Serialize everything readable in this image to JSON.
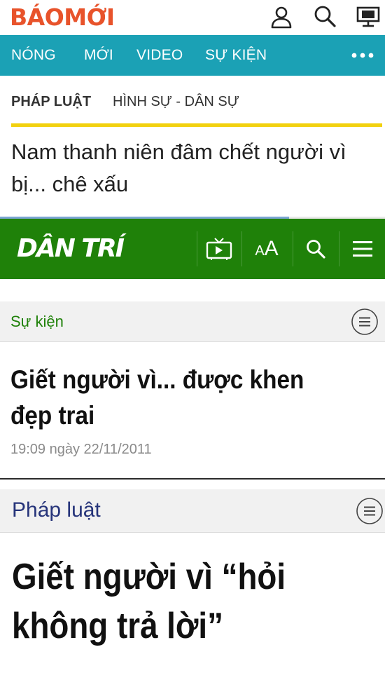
{
  "baomoi": {
    "logo_part1": "BÁO",
    "logo_part2": "MỚI",
    "header_icons": [
      "user-icon",
      "search-icon",
      "monitor-icon"
    ],
    "nav": {
      "items": [
        "NÓNG",
        "MỚI",
        "VIDEO",
        "SỰ KIỆN"
      ],
      "more_icon": "more-dots-icon"
    },
    "category": "PHÁP LUẬT",
    "subcategory": "HÌNH SỰ - DÂN SỰ",
    "article_title": "Nam thanh niên đâm chết người vì bị... chê xấu",
    "scroll_progress": 0.75,
    "colors": {
      "brand": "#e8532b",
      "nav_bg": "#1ba1b5",
      "accent_bar": "#f2d10f"
    }
  },
  "dantri": {
    "logo": "DÂN TRÍ",
    "header_icons": [
      "video-tv-icon",
      "font-size-icon",
      "search-icon",
      "menu-icon"
    ],
    "font_size_label_small": "A",
    "font_size_label_large": "A",
    "article1": {
      "section": "Sự kiện",
      "headline": "Giết người vì... được khen đẹp trai",
      "date": "19:09 ngày 22/11/2011"
    },
    "article2": {
      "section": "Pháp luật",
      "headline": "Giết người vì “hỏi không trả lời”"
    },
    "colors": {
      "header_bg": "#1f8109",
      "section1": "#1f8109",
      "section2": "#26347a"
    }
  }
}
